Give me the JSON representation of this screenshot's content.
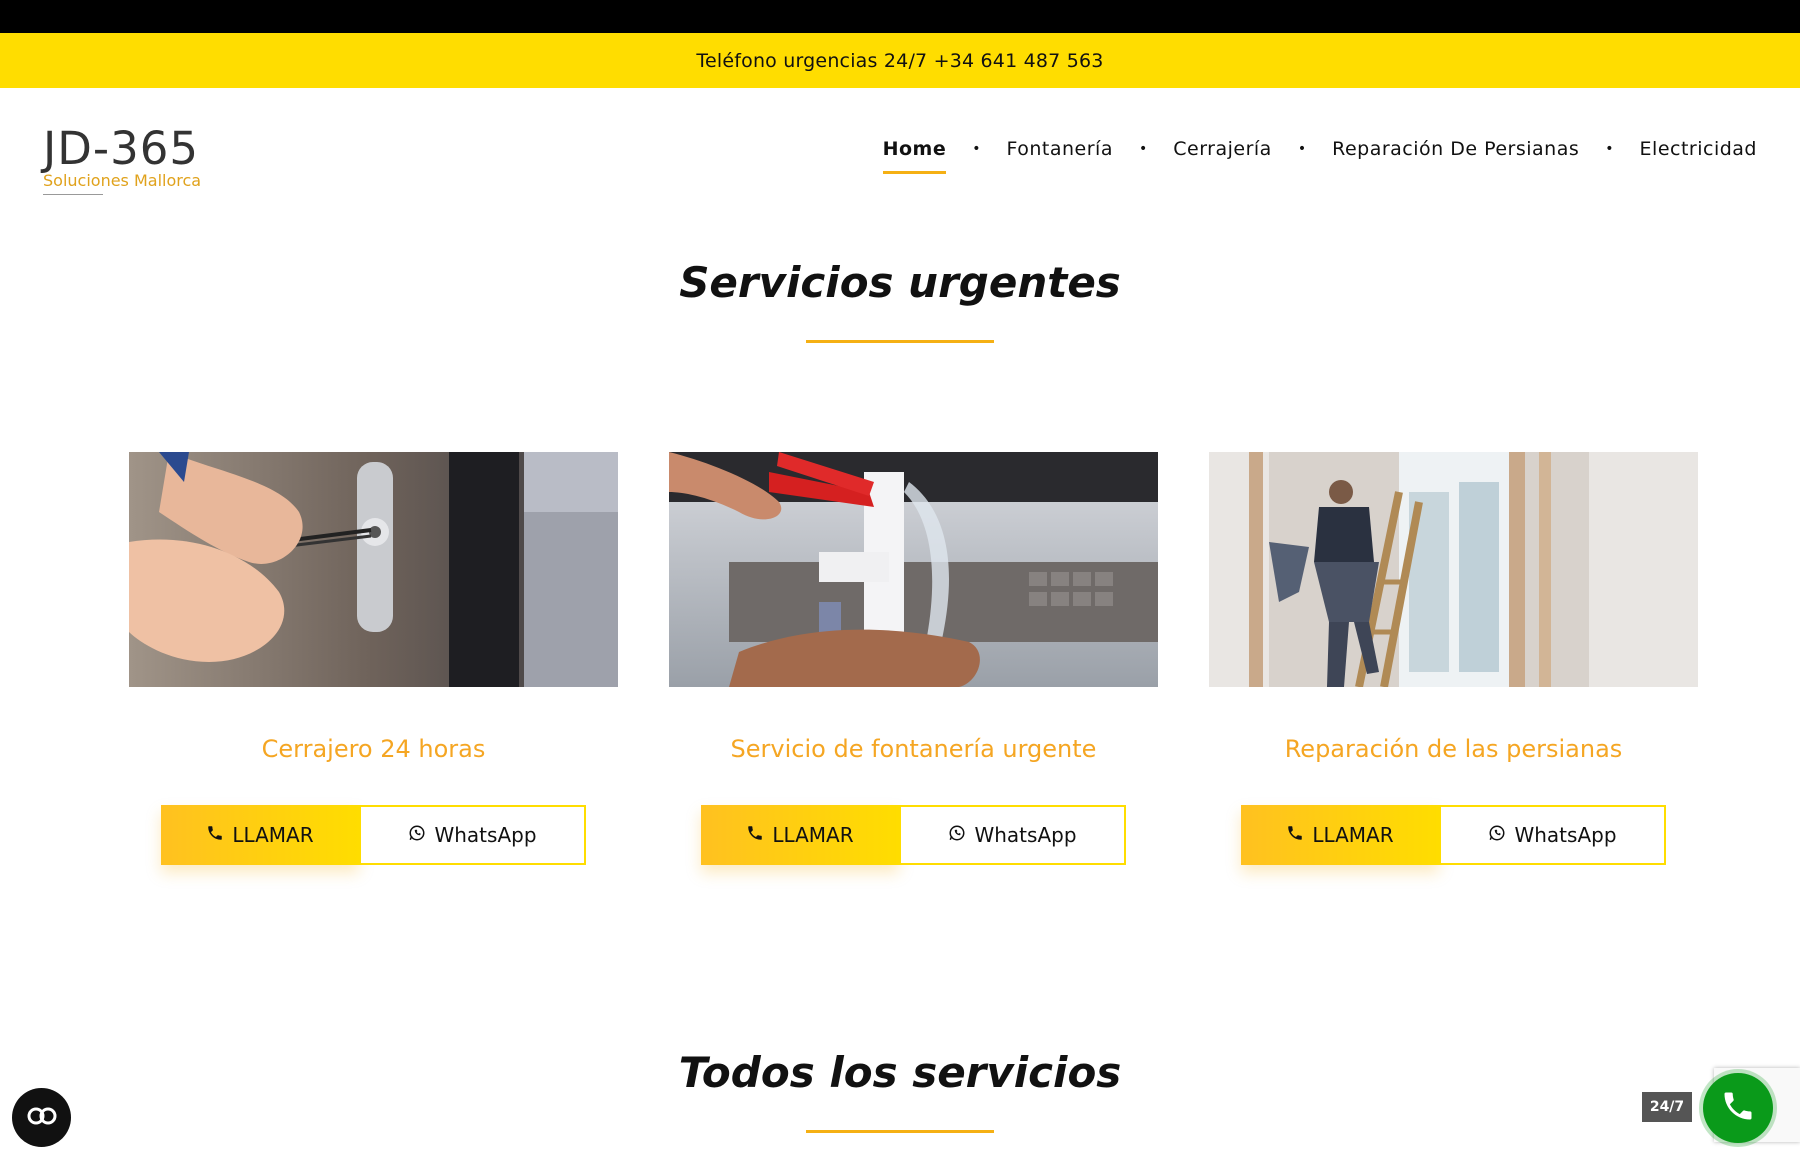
{
  "urgent_bar": {
    "text": "Teléfono urgencias 24/7 +34 641 487 563"
  },
  "logo": {
    "main": "JD-365",
    "sub": "Soluciones Mallorca"
  },
  "nav": {
    "items": [
      {
        "label": "Home",
        "active": true
      },
      {
        "label": "Fontanería",
        "active": false
      },
      {
        "label": "Cerrajería",
        "active": false
      },
      {
        "label": "Reparación De Persianas",
        "active": false
      },
      {
        "label": "Electricidad",
        "active": false
      }
    ]
  },
  "sections": {
    "urgent_title": "Servicios urgentes",
    "all_title": "Todos los servicios"
  },
  "cards": [
    {
      "title": "Cerrajero 24 horas",
      "call_label": "LLAMAR",
      "wa_label": "WhatsApp"
    },
    {
      "title": "Servicio de fontanería urgente",
      "call_label": "LLAMAR",
      "wa_label": "WhatsApp"
    },
    {
      "title": "Reparación de las persianas",
      "call_label": "LLAMAR",
      "wa_label": "WhatsApp"
    }
  ],
  "floating": {
    "badge": "24/7"
  },
  "colors": {
    "yellow": "#ffdd00",
    "accent": "#f5b014",
    "title_orange": "#f5a623",
    "call_green": "#0a9a1a"
  }
}
